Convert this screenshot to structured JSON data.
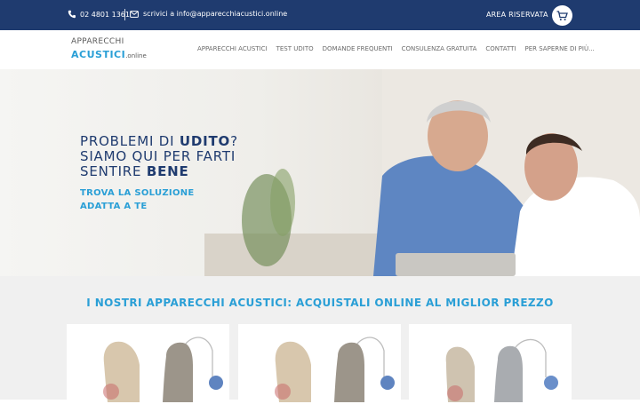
{
  "topbar": {
    "phone": "02 4801 1361",
    "email_text": "scrivici a info@apparecchiacustici.online",
    "area_label": "AREA RISERVATA"
  },
  "logo": {
    "line1": "APPARECCHI",
    "line2": "ACUSTICI",
    "line3": ".online"
  },
  "nav": {
    "items": [
      "APPARECCHI ACUSTICI",
      "TEST UDITO",
      "DOMANDE FREQUENTI",
      "CONSULENZA GRATUITA",
      "CONTATTI",
      "PER SAPERNE DI PIÙ..."
    ]
  },
  "hero": {
    "line1_a": "PROBLEMI DI ",
    "line1_b": "UDITO",
    "line1_c": "?",
    "line2": "SIAMO QUI PER FARTI",
    "line3_a": "SENTIRE ",
    "line3_b": "BENE",
    "cta_line1": "TROVA LA SOLUZIONE",
    "cta_line2": "ADATTA A TE"
  },
  "products": {
    "title": "I NOSTRI APPARECCHI ACUSTICI: ACQUISTALI ONLINE AL MIGLIOR PREZZO"
  },
  "colors": {
    "topbar_bg": "#1f3b6f",
    "accent": "#2a9fd6",
    "hero_text": "#1f3b6f"
  }
}
